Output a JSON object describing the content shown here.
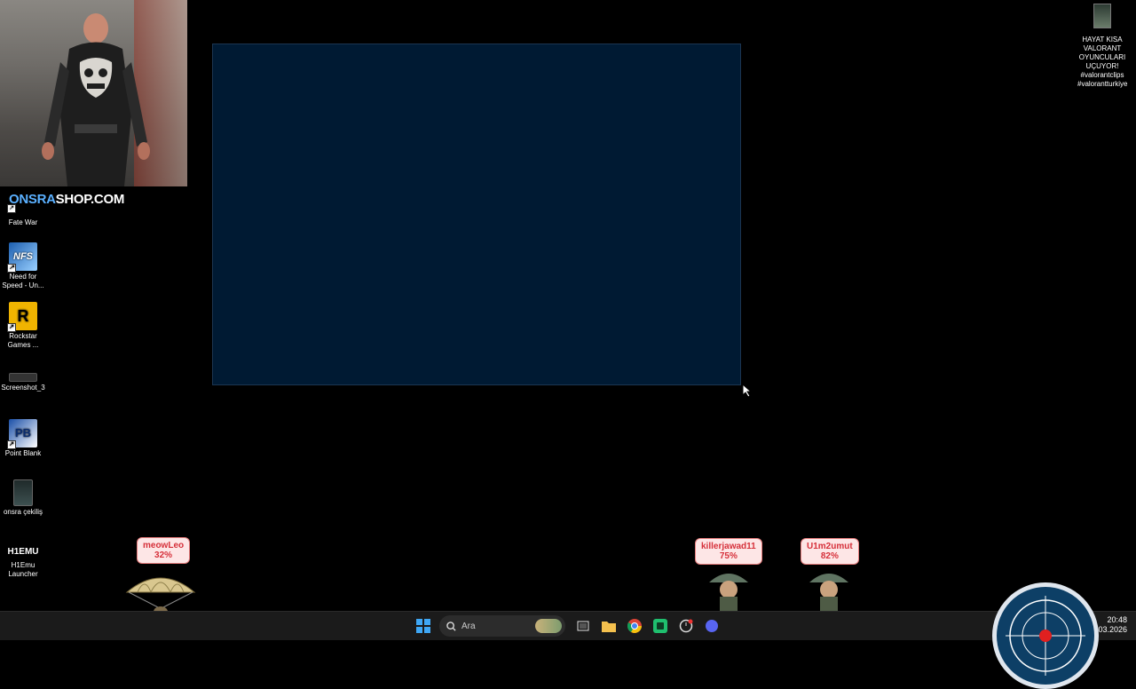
{
  "overlay": {
    "banner_part1": "ONSRA",
    "banner_part2": "SHOP.COM"
  },
  "desktop_icons": [
    {
      "label": "Fate War",
      "icon": "fate-war-icon"
    },
    {
      "label": "Need for Speed - Un...",
      "icon": "nfs-icon",
      "logo_text": "NFS"
    },
    {
      "label": "Rockstar Games ...",
      "icon": "rockstar-icon",
      "logo_text": "R"
    },
    {
      "label": "Screenshot_3",
      "icon": "screenshot-icon"
    },
    {
      "label": "Point Blank",
      "icon": "point-blank-icon",
      "logo_text": "PB"
    },
    {
      "label": "onsra çekiliş",
      "icon": "file-icon"
    },
    {
      "label": "H1Emu Launcher",
      "icon": "h1emu-icon",
      "logo_text": "H1EMU"
    }
  ],
  "right_file": {
    "label": "HAYAT KISA VALORANT OYUNCULARI UÇUYOR! #valorantclips #valorantturkiye",
    "icon": "video-file-icon"
  },
  "parachuters": [
    {
      "name": "meowLeo",
      "percent": "32%"
    },
    {
      "name": "killerjawad11",
      "percent": "75%"
    },
    {
      "name": "U1m2umut",
      "percent": "82%"
    }
  ],
  "taskbar": {
    "search_placeholder": "Ara",
    "time": "20:48",
    "date": "03.2026"
  },
  "colors": {
    "window_bg": "#001a33",
    "tag_text": "#d6303a",
    "banner_accent": "#5ab0ff"
  }
}
